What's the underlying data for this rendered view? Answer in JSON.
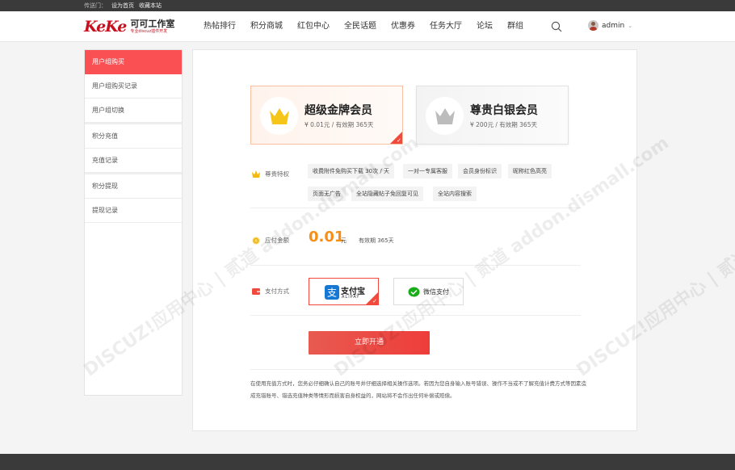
{
  "topbar": {
    "label": "传送门：",
    "links": [
      "设为首页",
      "收藏本站"
    ]
  },
  "logo": {
    "mark": "KeKe",
    "name": "可可工作室",
    "sub": "专业discuz插件开发"
  },
  "nav": {
    "items": [
      "热帖排行",
      "积分商城",
      "红包中心",
      "全民话题",
      "优惠券",
      "任务大厅",
      "论坛",
      "群组"
    ],
    "username": "admin"
  },
  "sidebar": {
    "items": [
      "用户组购买",
      "用户组购买记录",
      "用户组切换",
      "积分充值",
      "充值记录",
      "积分提现",
      "提现记录"
    ]
  },
  "cards": [
    {
      "title": "超级金牌会员",
      "price": "¥ 0.01元 / 有效期 365天",
      "color": "#f5c518"
    },
    {
      "title": "尊贵白银会员",
      "price": "¥ 200元 / 有效期 365天",
      "color": "#bcbcbc"
    }
  ],
  "privileges": {
    "label": "尊贵特权",
    "tags": [
      "收费附件免购买下载 30次 / 天",
      "一对一专属客服",
      "会员身份标识",
      "昵称红色高亮",
      "页面无广告",
      "全站隐藏帖子免回复可见",
      "全站内容搜索"
    ]
  },
  "payment_amount": {
    "label": "应付金额",
    "value": "0.01",
    "unit": "元",
    "expiry": "有效期 365天"
  },
  "payment_method": {
    "label": "支付方式",
    "alipay_cn": "支付宝",
    "alipay_en": "ALIPAY",
    "wechat": "微信支付"
  },
  "submit_label": "立即开通",
  "notice": "在使用充值方式时，您务必仔细确认自己的账号并仔细选择相关操作选项。若因为您自身输入账号错误、操作不当或不了解充值计费方式等因素造成充错账号、错选充值种类等情形而损害自身权益的，网站将不会作出任何补偿或赔偿。",
  "watermark": "DISCUZ!应用中心 | 贰道 addon.dismall.com"
}
